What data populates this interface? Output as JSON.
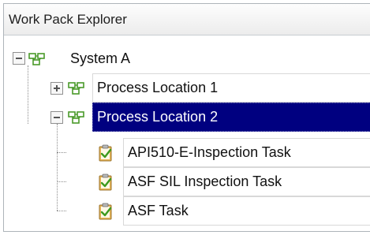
{
  "panel": {
    "title": "Work Pack Explorer"
  },
  "tree": {
    "root": {
      "label": "System A",
      "expanded": true,
      "icon": "process-group-icon"
    },
    "locations": [
      {
        "label": "Process Location 1",
        "expanded": false,
        "selected": false,
        "icon": "process-group-icon"
      },
      {
        "label": "Process Location 2",
        "expanded": true,
        "selected": true,
        "icon": "process-group-icon"
      }
    ],
    "tasks": [
      {
        "label": "API510-E-Inspection Task",
        "icon": "task-clipboard-check-icon"
      },
      {
        "label": "ASF SIL Inspection Task",
        "icon": "task-clipboard-check-icon"
      },
      {
        "label": "ASF Task",
        "icon": "task-clipboard-check-icon"
      }
    ]
  },
  "colors": {
    "selection": "#000080",
    "selection_text": "#ffffff",
    "icon_green": "#4a9a2a",
    "icon_clipboard": "#d9a441"
  }
}
